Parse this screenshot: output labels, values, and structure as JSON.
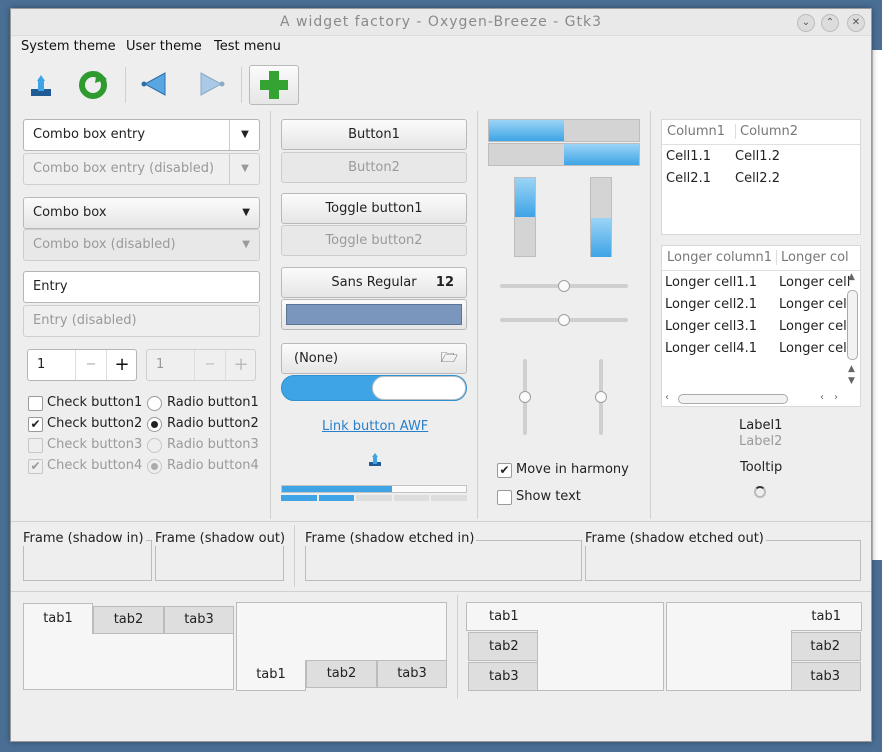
{
  "window": {
    "title": "A widget factory - Oxygen-Breeze - Gtk3"
  },
  "menu": [
    "System theme",
    "User theme",
    "Test menu"
  ],
  "combos": {
    "entry": "Combo box entry",
    "entry_disabled": "Combo box entry (disabled)",
    "box": "Combo box",
    "box_disabled": "Combo box (disabled)"
  },
  "entries": {
    "entry": "Entry",
    "entry_disabled": "Entry (disabled)"
  },
  "spin": {
    "value": "1",
    "value_disabled": "1",
    "minus": "−",
    "plus": "+"
  },
  "checks": [
    {
      "label": "Check button1",
      "checked": false
    },
    {
      "label": "Check button2",
      "checked": true
    },
    {
      "label": "Check button3",
      "checked": false
    },
    {
      "label": "Check button4",
      "checked": true
    }
  ],
  "radios": [
    {
      "label": "Radio button1"
    },
    {
      "label": "Radio button2"
    },
    {
      "label": "Radio button3"
    },
    {
      "label": "Radio button4"
    }
  ],
  "buttons": {
    "button1": "Button1",
    "button2": "Button2",
    "toggle1": "Toggle button1",
    "toggle2": "Toggle button2",
    "font_name": "Sans Regular",
    "font_size": "12",
    "file_none": "(None)",
    "link": "Link button AWF"
  },
  "colors": {
    "accent": "#3ea4e6",
    "color_button": "#7b96bd"
  },
  "options": {
    "move_harmony": "Move in harmony",
    "show_text": "Show text"
  },
  "tree1": {
    "headers": [
      "Column1",
      "Column2"
    ],
    "rows": [
      [
        "Cell1.1",
        "Cell1.2"
      ],
      [
        "Cell2.1",
        "Cell2.2"
      ]
    ]
  },
  "tree2": {
    "headers": [
      "Longer column1",
      "Longer col"
    ],
    "rows": [
      [
        "Longer cell1.1",
        "Longer cell"
      ],
      [
        "Longer cell2.1",
        "Longer cell"
      ],
      [
        "Longer cell3.1",
        "Longer cell"
      ],
      [
        "Longer cell4.1",
        "Longer cell"
      ]
    ]
  },
  "labels": {
    "label1": "Label1",
    "label2": "Label2",
    "tooltip": "Tooltip"
  },
  "frames": {
    "in": "Frame (shadow in)",
    "out": "Frame (shadow out)",
    "etched_in": "Frame (shadow etched in)",
    "etched_out": "Frame (shadow etched out)"
  },
  "tabs": [
    "tab1",
    "tab2",
    "tab3"
  ]
}
